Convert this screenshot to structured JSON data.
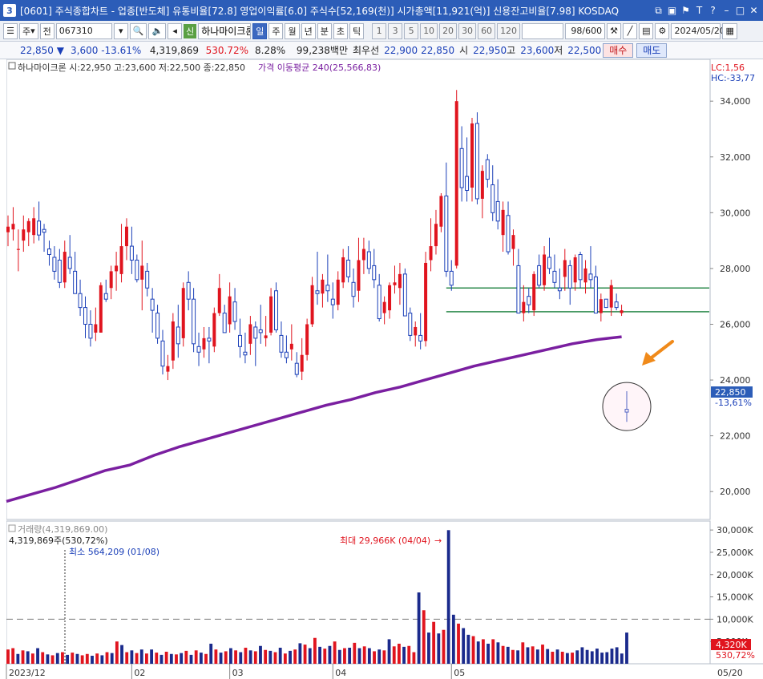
{
  "window": {
    "badge": "3",
    "title": "[0601] 주식종합차트 - 업종[반도체] 유통비율[72.8] 영업이익률[6.0] 주식수[52,169(천)] 시가총액[11,921(억)] 신용잔고비율[7.98] KOSDAQ"
  },
  "toolbar": {
    "period_type": "주",
    "prev": "전",
    "code": "067310",
    "stock_name": "하나마이크론",
    "sin_badge": "신",
    "periods": [
      "일",
      "주",
      "월",
      "년",
      "분",
      "초",
      "틱"
    ],
    "active_period": "일",
    "intervals": [
      "1",
      "3",
      "5",
      "10",
      "20",
      "30",
      "60",
      "120"
    ],
    "count": "98",
    "count_max": "/600",
    "date": "2024/05/20"
  },
  "quote": {
    "price": "22,850",
    "down_arrow": "▼",
    "change": "3,600",
    "change_pct": "-13.61%",
    "volume": "4,319,869",
    "volume_ratio": "530.72%",
    "turnover": "8.28%",
    "amount": "99,238백만",
    "best_ask_label": "최우선",
    "best_ask": "22,900",
    "best_bid": "22,850",
    "open_label": "시",
    "open": "22,950",
    "high_label": "고",
    "high": "23,600",
    "low_label": "저",
    "low": "22,500",
    "buy": "매수",
    "sell": "매도"
  },
  "price_panel": {
    "legend_ohlc": "하나마이크론 시:22,950 고:23,600 저:22,500 종:22,850",
    "legend_ma": "가격 이동평균 240(25,566,83)",
    "lc": "LC:1,56",
    "hc": "HC:-33,77",
    "current_price_tag": "22,850",
    "current_change_tag": "-13,61%"
  },
  "volume_panel": {
    "legend": "거래량(4,319,869.00)",
    "current": "4,319,869주(530,72%)",
    "min_note": "최소 564,209 (01/08)",
    "max_note": "최대 29,966K (04/04)",
    "current_tag": "4,320K",
    "current_pct_tag": "530,72%"
  },
  "date_axis": [
    "2023/12",
    "02",
    "03",
    "04",
    "05",
    "05/20"
  ],
  "chart_data": [
    {
      "type": "candlestick",
      "ylim": [
        19000,
        35500
      ],
      "y_ticks": [
        "34,000",
        "32,000",
        "30,000",
        "28,000",
        "26,000",
        "24,000",
        "22,000",
        "20,000"
      ],
      "candles": [
        [
          29300,
          29900,
          28800,
          29500
        ],
        [
          29400,
          30200,
          29000,
          29600
        ],
        [
          28700,
          29400,
          27900,
          28700
        ],
        [
          29000,
          29900,
          28600,
          29400
        ],
        [
          29300,
          29800,
          28800,
          29700
        ],
        [
          29200,
          30200,
          28900,
          29800
        ],
        [
          29700,
          30400,
          29000,
          29200
        ],
        [
          29400,
          29600,
          28600,
          29300
        ],
        [
          28700,
          29000,
          28100,
          28500
        ],
        [
          28400,
          28800,
          27600,
          27900
        ],
        [
          28300,
          28700,
          27300,
          27500
        ],
        [
          27500,
          29000,
          27300,
          28600
        ],
        [
          28400,
          29200,
          27800,
          28000
        ],
        [
          27900,
          28600,
          27100,
          27100
        ],
        [
          27100,
          27600,
          26300,
          26600
        ],
        [
          26600,
          27000,
          25500,
          26000
        ],
        [
          26000,
          26500,
          25200,
          25500
        ],
        [
          25700,
          26600,
          25400,
          26000
        ],
        [
          25700,
          27500,
          25700,
          27400
        ],
        [
          27100,
          27600,
          26800,
          26900
        ],
        [
          27300,
          28100,
          26900,
          27900
        ],
        [
          27900,
          28600,
          27200,
          28100
        ],
        [
          27800,
          29600,
          27500,
          28800
        ],
        [
          28800,
          29800,
          28300,
          29500
        ],
        [
          28800,
          29500,
          27800,
          28300
        ],
        [
          28300,
          28500,
          27500,
          27600
        ],
        [
          27600,
          29000,
          26500,
          28100
        ],
        [
          27900,
          28200,
          27000,
          27300
        ],
        [
          26900,
          27300,
          25700,
          26500
        ],
        [
          26400,
          26700,
          25300,
          25500
        ],
        [
          25400,
          25800,
          24200,
          24500
        ],
        [
          24300,
          24900,
          24000,
          24500
        ],
        [
          24700,
          26400,
          24400,
          26100
        ],
        [
          25900,
          26700,
          24800,
          25300
        ],
        [
          25500,
          27500,
          25200,
          27300
        ],
        [
          27500,
          27900,
          26500,
          26900
        ],
        [
          26900,
          27300,
          25000,
          25300
        ],
        [
          25200,
          25700,
          24500,
          25000
        ],
        [
          25100,
          25900,
          24800,
          25500
        ],
        [
          25500,
          25900,
          24600,
          25400
        ],
        [
          25200,
          26600,
          25000,
          26400
        ],
        [
          26400,
          27800,
          26300,
          27300
        ],
        [
          26400,
          26700,
          25700,
          25700
        ],
        [
          26000,
          27500,
          25700,
          27000
        ],
        [
          26800,
          27300,
          25800,
          26100
        ],
        [
          25600,
          26200,
          24800,
          25200
        ],
        [
          25000,
          25700,
          24600,
          24900
        ],
        [
          25300,
          26300,
          24900,
          26000
        ],
        [
          25900,
          26100,
          24500,
          25500
        ],
        [
          25800,
          26700,
          25300,
          25700
        ],
        [
          25500,
          26300,
          25200,
          25600
        ],
        [
          25700,
          27300,
          25600,
          27000
        ],
        [
          27200,
          27500,
          25700,
          25800
        ],
        [
          25600,
          26100,
          24800,
          25000
        ],
        [
          25000,
          25600,
          24600,
          24800
        ],
        [
          25100,
          26000,
          24700,
          25300
        ],
        [
          24600,
          25000,
          24100,
          24200
        ],
        [
          24300,
          25500,
          24000,
          24900
        ],
        [
          24900,
          26200,
          24700,
          26000
        ],
        [
          26000,
          27700,
          25900,
          27400
        ],
        [
          27200,
          28600,
          26700,
          27100
        ],
        [
          27100,
          27800,
          26600,
          27600
        ],
        [
          27400,
          28500,
          26800,
          27200
        ],
        [
          26900,
          27500,
          26200,
          26700
        ],
        [
          26700,
          27900,
          26500,
          27600
        ],
        [
          27500,
          28700,
          27300,
          28400
        ],
        [
          28300,
          28800,
          27500,
          27700
        ],
        [
          27500,
          28000,
          26600,
          27000
        ],
        [
          27200,
          29100,
          26800,
          28300
        ],
        [
          28300,
          29100,
          27800,
          28700
        ],
        [
          28600,
          29000,
          27800,
          28000
        ],
        [
          28100,
          28700,
          27300,
          27600
        ],
        [
          27400,
          27800,
          26100,
          26200
        ],
        [
          26400,
          27000,
          26000,
          26800
        ],
        [
          26500,
          27500,
          26200,
          27400
        ],
        [
          27400,
          28100,
          27100,
          27500
        ],
        [
          27300,
          28200,
          26700,
          27800
        ],
        [
          27800,
          28000,
          26300,
          26300
        ],
        [
          26400,
          26600,
          25400,
          25600
        ],
        [
          25600,
          26100,
          25200,
          25900
        ],
        [
          25600,
          26400,
          25100,
          25400
        ],
        [
          25400,
          28600,
          25200,
          28200
        ],
        [
          28300,
          29800,
          27900,
          28800
        ],
        [
          28800,
          30100,
          28500,
          29600
        ],
        [
          29500,
          30700,
          29300,
          30600
        ],
        [
          30600,
          31800,
          27700,
          27900
        ],
        [
          27900,
          28300,
          27200,
          27400
        ],
        [
          28100,
          34400,
          28000,
          34000
        ],
        [
          32300,
          33100,
          30400,
          30900
        ],
        [
          31300,
          32700,
          30400,
          30800
        ],
        [
          30900,
          33400,
          30400,
          33200
        ],
        [
          33200,
          33600,
          30300,
          30500
        ],
        [
          30500,
          31700,
          29800,
          31500
        ],
        [
          31900,
          32100,
          30900,
          31200
        ],
        [
          31000,
          31700,
          29700,
          30000
        ],
        [
          30400,
          31200,
          29400,
          29700
        ],
        [
          29200,
          30400,
          28600,
          30100
        ],
        [
          29900,
          30400,
          28500,
          28600
        ],
        [
          28700,
          29400,
          28100,
          29200
        ],
        [
          28100,
          28700,
          26400,
          26400
        ],
        [
          26400,
          27400,
          26100,
          26800
        ],
        [
          27000,
          27300,
          26400,
          26700
        ],
        [
          26500,
          27900,
          26300,
          27800
        ],
        [
          28100,
          28500,
          27300,
          27400
        ],
        [
          27400,
          28800,
          27200,
          28500
        ],
        [
          28400,
          29100,
          27800,
          28000
        ],
        [
          27900,
          28500,
          27300,
          27500
        ],
        [
          27300,
          28000,
          26900,
          27200
        ],
        [
          27700,
          28700,
          27200,
          28300
        ],
        [
          28100,
          28300,
          26700,
          27300
        ],
        [
          27500,
          28500,
          27200,
          28400
        ],
        [
          28500,
          28600,
          27300,
          27600
        ],
        [
          27500,
          28300,
          27100,
          28000
        ],
        [
          27800,
          28800,
          27300,
          27600
        ],
        [
          27700,
          28100,
          26400,
          26400
        ],
        [
          26400,
          27100,
          26100,
          26900
        ],
        [
          26900,
          26700,
          26600,
          26600
        ],
        [
          26600,
          27600,
          26300,
          27400
        ],
        [
          26800,
          27100,
          26500,
          26600
        ],
        [
          26400,
          26700,
          26300,
          26500
        ],
        [
          22950,
          23600,
          22500,
          22850
        ]
      ],
      "ma240": [
        19650,
        19900,
        20150,
        20450,
        20750,
        20950,
        21300,
        21600,
        21850,
        22100,
        22350,
        22600,
        22850,
        23100,
        23300,
        23550,
        23750,
        24000,
        24250,
        24500,
        24700,
        24900,
        25100,
        25300,
        25450,
        25550
      ],
      "ma_label": "가격 이동평균 240(25,566,83)",
      "support_line": 26450,
      "resistance_line": 27300
    },
    {
      "type": "bar",
      "ylim": [
        0,
        32000
      ],
      "y_ticks": [
        "30,000K",
        "25,000K",
        "20,000K",
        "15,000K",
        "10,000K",
        "5,000K"
      ],
      "avg_line": 10000,
      "values": [
        3200,
        3500,
        2200,
        3000,
        2800,
        2300,
        3500,
        2600,
        2100,
        1900,
        2400,
        2600,
        2000,
        2500,
        2200,
        1900,
        2200,
        1800,
        2300,
        1900,
        2600,
        2400,
        5000,
        4200,
        2600,
        3000,
        2400,
        3200,
        2300,
        3200,
        2500,
        2000,
        2700,
        2200,
        2100,
        2400,
        2900,
        2000,
        3000,
        2500,
        2200,
        4500,
        3200,
        2500,
        2800,
        3500,
        3000,
        2600,
        3600,
        3000,
        2800,
        4000,
        3100,
        2900,
        2600,
        3600,
        2300,
        2900,
        3200,
        4600,
        4300,
        3500,
        5800,
        3800,
        3400,
        4000,
        5000,
        3100,
        3500,
        3600,
        4700,
        3500,
        3900,
        3500,
        2800,
        3200,
        3000,
        5500,
        3900,
        4500,
        3800,
        4000,
        2600,
        16000,
        12000,
        7000,
        9400,
        6800,
        7600,
        29966,
        11000,
        9000,
        8000,
        6500,
        6200,
        5000,
        5500,
        4500,
        5500,
        4800,
        4000,
        3800,
        3100,
        3000,
        4800,
        3700,
        3900,
        3200,
        4300,
        3300,
        2700,
        3200,
        2700,
        2400,
        2500,
        3000,
        3700,
        3100,
        2800,
        3400,
        2500,
        2600,
        3400,
        3700,
        2300,
        7000
      ],
      "up_flags": "rrbrbrbrbrbrbrbrrbrbrbrbrbrbrbrbrbrbrbrbrbrbrbrbrbrbrbrbrbrbrbrbrbrbrbrbrbrbrbrrbrrbrbrbrbbrbbrbrbrbrbrbrbrbrbrbrbrbb"
    }
  ]
}
